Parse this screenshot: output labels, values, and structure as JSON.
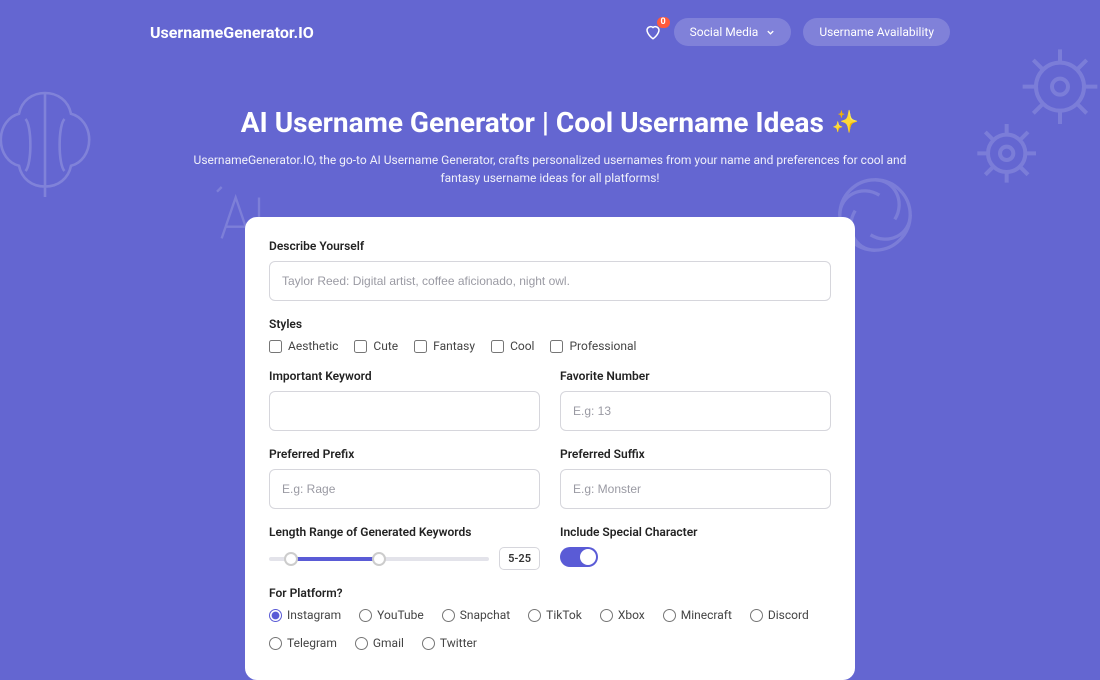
{
  "header": {
    "logo": "UsernameGenerator.IO",
    "favorites_count": "0",
    "nav": {
      "social": "Social Media",
      "availability": "Username Availability"
    }
  },
  "hero": {
    "title": "AI Username Generator | Cool Username Ideas",
    "subtitle": "UsernameGenerator.IO, the go-to AI Username Generator, crafts personalized usernames from your name and preferences for cool and fantasy username ideas for all platforms!"
  },
  "form": {
    "describe_label": "Describe Yourself",
    "describe_placeholder": "Taylor Reed: Digital artist, coffee aficionado, night owl.",
    "styles_label": "Styles",
    "styles": [
      "Aesthetic",
      "Cute",
      "Fantasy",
      "Cool",
      "Professional"
    ],
    "keyword_label": "Important Keyword",
    "favorite_number_label": "Favorite Number",
    "favorite_number_placeholder": "E.g: 13",
    "prefix_label": "Preferred Prefix",
    "prefix_placeholder": "E.g: Rage",
    "suffix_label": "Preferred Suffix",
    "suffix_placeholder": "E.g: Monster",
    "length_label": "Length Range of Generated Keywords",
    "length_range": "5-25",
    "special_label": "Include Special Character",
    "platform_label": "For Platform?",
    "platforms": [
      "Instagram",
      "YouTube",
      "Snapchat",
      "TikTok",
      "Xbox",
      "Minecraft",
      "Discord",
      "Telegram",
      "Gmail",
      "Twitter"
    ],
    "selected_platform": "Instagram"
  }
}
